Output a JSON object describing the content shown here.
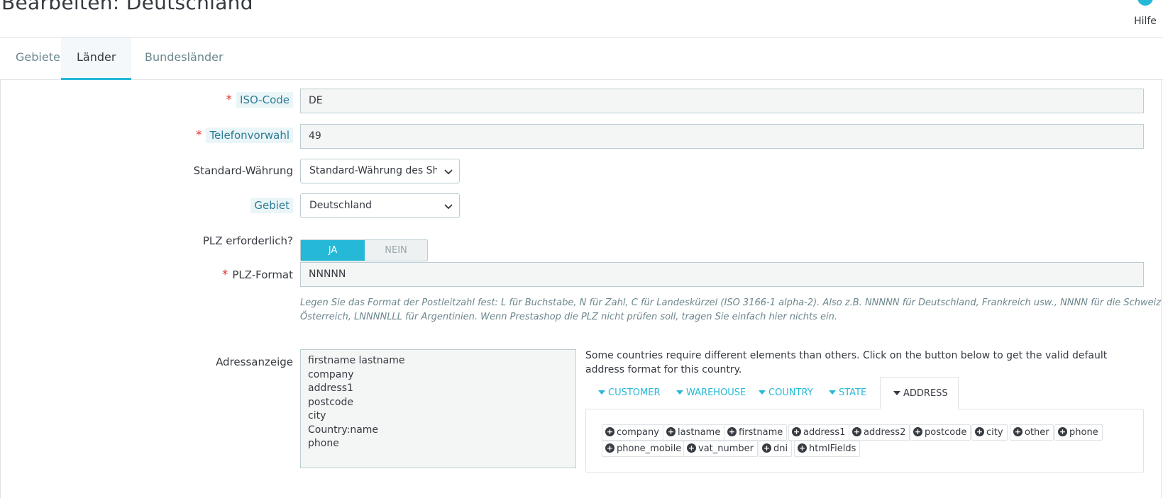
{
  "header": {
    "title": "Bearbeiten: Deutschland",
    "help_label": "Hilfe"
  },
  "tabs": [
    {
      "label": "Gebiete",
      "active": false
    },
    {
      "label": "Länder",
      "active": true
    },
    {
      "label": "Bundesländer",
      "active": false
    }
  ],
  "form": {
    "iso_code": {
      "label": "ISO-Code",
      "required": "*",
      "value": "DE"
    },
    "phone_prefix": {
      "label": "Telefonvorwahl",
      "required": "*",
      "value": "49"
    },
    "default_currency": {
      "label": "Standard-Währung",
      "value": "Standard-Währung des Shop"
    },
    "zone": {
      "label": "Gebiet",
      "value": "Deutschland"
    },
    "zip_required": {
      "label": "PLZ erforderlich?",
      "yes": "JA",
      "no": "NEIN",
      "selected": "JA"
    },
    "zip_format": {
      "label": "PLZ-Format",
      "required": "*",
      "value": "NNNNN",
      "help_line1": "Legen Sie das Format der Postleitzahl fest: L für Buchstabe, N für Zahl, C für Landeskürzel (ISO 3166-1 alpha-2). Also z.B. NNNNN für Deutschland, Frankreich usw., NNNN für die Schweiz oder",
      "help_line2": "Österreich, LNNNNLLL für Argentinien. Wenn Prestashop die PLZ nicht prüfen soll, tragen Sie einfach hier nichts ein."
    },
    "address_layout": {
      "label": "Adressanzeige",
      "lines": [
        "firstname lastname",
        "company",
        "address1",
        "postcode",
        "city",
        "Country:name",
        "phone"
      ],
      "help": "Some countries require different elements than others. Click on the button below to get the valid default address format for this country."
    }
  },
  "address_tabs": [
    {
      "label": "CUSTOMER",
      "active": false
    },
    {
      "label": "WAREHOUSE",
      "active": false
    },
    {
      "label": "COUNTRY",
      "active": false
    },
    {
      "label": "STATE",
      "active": false
    },
    {
      "label": "ADDRESS",
      "active": true
    }
  ],
  "address_fields_row1": [
    "company",
    "lastname",
    "firstname",
    "address1",
    "address2",
    "postcode",
    "city",
    "other",
    "phone"
  ],
  "address_fields_row2": [
    "phone_mobile",
    "vat_number",
    "dni",
    "htmlFields"
  ],
  "colors": {
    "accent": "#25b9d7",
    "required": "#e03030",
    "text": "#363a41",
    "muted": "#6c868e"
  }
}
